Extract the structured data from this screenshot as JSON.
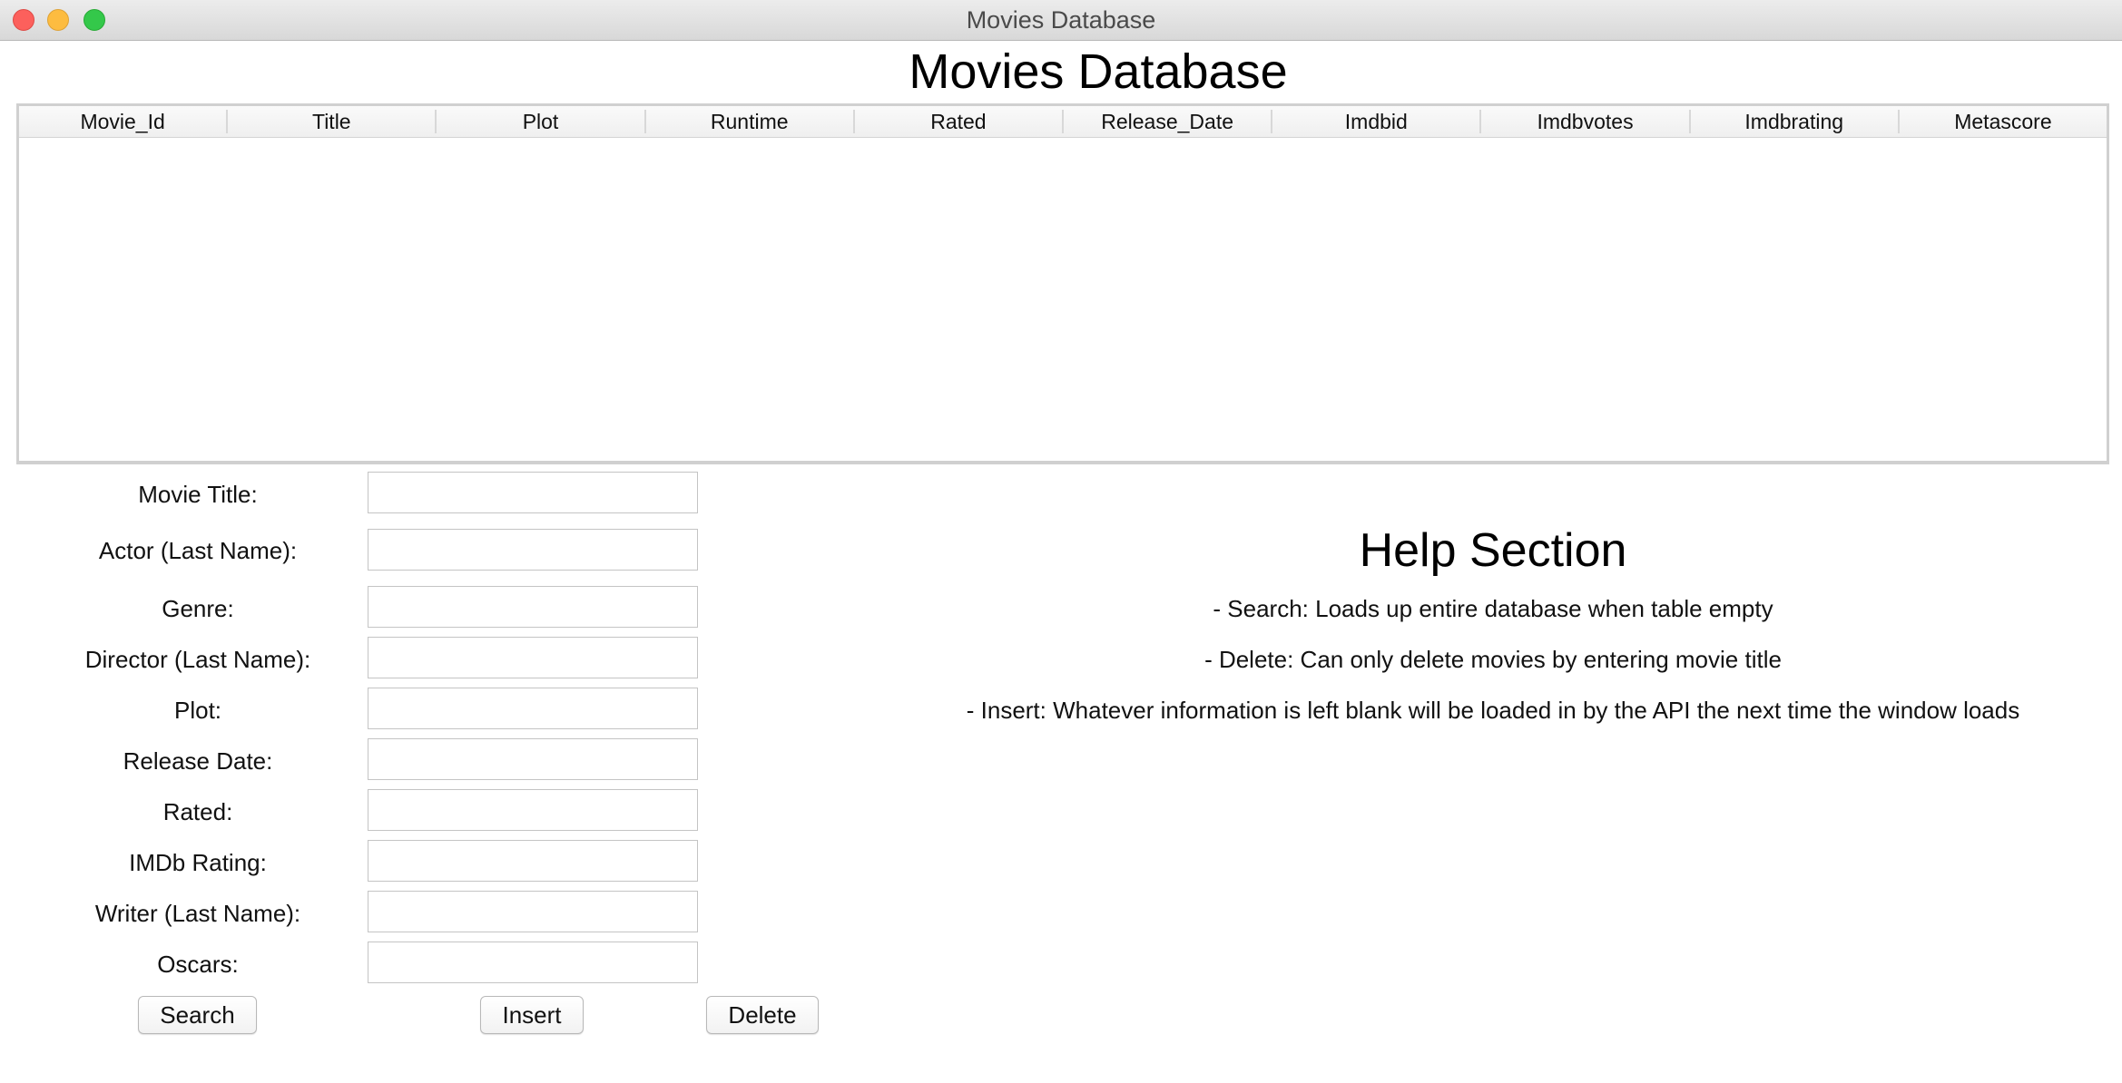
{
  "window": {
    "title": "Movies Database"
  },
  "heading": "Movies Database",
  "table": {
    "columns": [
      "Movie_Id",
      "Title",
      "Plot",
      "Runtime",
      "Rated",
      "Release_Date",
      "Imdbid",
      "Imdbvotes",
      "Imdbrating",
      "Metascore"
    ],
    "rows": []
  },
  "form": {
    "fields": [
      {
        "label": "Movie Title:",
        "value": ""
      },
      {
        "label": "Actor (Last Name):",
        "value": ""
      },
      {
        "label": "Genre:",
        "value": ""
      },
      {
        "label": "Director (Last Name):",
        "value": ""
      },
      {
        "label": "Plot:",
        "value": ""
      },
      {
        "label": "Release Date:",
        "value": ""
      },
      {
        "label": "Rated:",
        "value": ""
      },
      {
        "label": "IMDb Rating:",
        "value": ""
      },
      {
        "label": "Writer (Last Name):",
        "value": ""
      },
      {
        "label": "Oscars:",
        "value": ""
      }
    ],
    "buttons": {
      "search": "Search",
      "insert": "Insert",
      "delete": "Delete"
    }
  },
  "help": {
    "heading": "Help Section",
    "lines": [
      "- Search:  Loads up entire database when table empty",
      "- Delete:  Can only delete movies by entering movie title",
      "- Insert:  Whatever information is left blank will be loaded in by the API the next time the window loads"
    ]
  },
  "colors": {
    "close": "#fc605c",
    "minimize": "#fdbc40",
    "maximize": "#34c84a"
  }
}
